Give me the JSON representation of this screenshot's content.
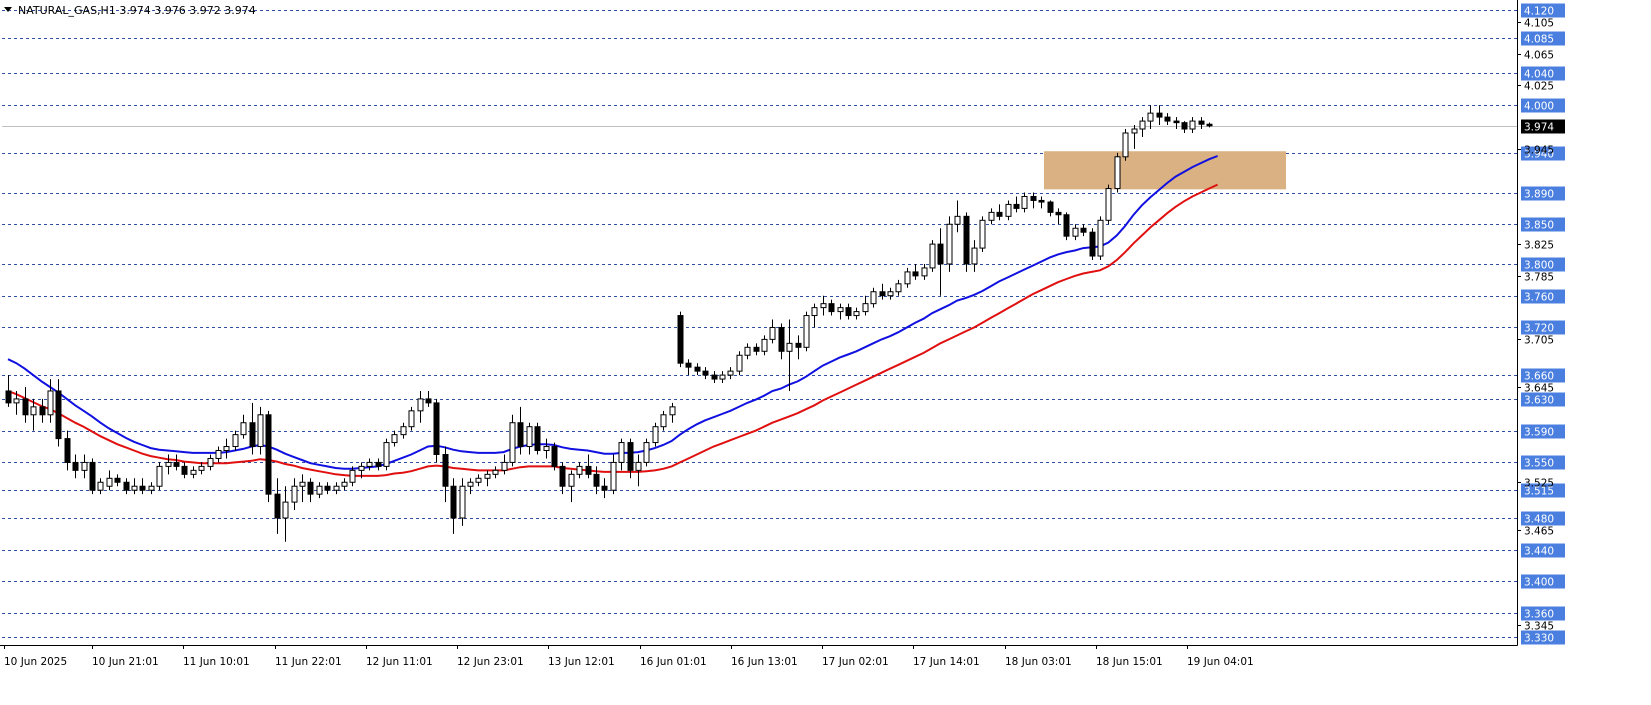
{
  "header": {
    "symbol_line": "NATURAL_GAS,H1  3.974 3.976 3.972 3.974"
  },
  "colors": {
    "level_line": "#2f4fa2",
    "level_badge": "#4a7fe0",
    "ema_fast": "#1010e0",
    "ema_slow": "#e01010",
    "zone": "#d9b183",
    "price_badge": "#000000"
  },
  "chart_data": {
    "type": "candlestick",
    "timeframe": "H1",
    "ylim": [
      3.32,
      4.13
    ],
    "current_price": 3.974,
    "x_labels": [
      "10 Jun 2025",
      "10 Jun 21:01",
      "11 Jun 10:01",
      "11 Jun 22:01",
      "12 Jun 11:01",
      "12 Jun 23:01",
      "13 Jun 12:01",
      "16 Jun 01:01",
      "16 Jun 13:01",
      "17 Jun 02:01",
      "17 Jun 14:01",
      "18 Jun 03:01",
      "18 Jun 15:01",
      "19 Jun 04:01"
    ],
    "price_ticks": [
      "4.105",
      "4.065",
      "4.025",
      "3.945",
      "3.825",
      "3.785",
      "3.705",
      "3.645",
      "3.525",
      "3.465",
      "3.345"
    ],
    "levels": [
      "4.120",
      "4.085",
      "4.040",
      "4.000",
      "3.940",
      "3.890",
      "3.850",
      "3.800",
      "3.760",
      "3.720",
      "3.660",
      "3.630",
      "3.590",
      "3.550",
      "3.515",
      "3.480",
      "3.440",
      "3.400",
      "3.360",
      "3.330"
    ],
    "zone": {
      "low": 3.894,
      "high": 3.942
    },
    "candles": [
      [
        3.64,
        3.66,
        3.62,
        3.625
      ],
      [
        3.625,
        3.64,
        3.61,
        3.63
      ],
      [
        3.63,
        3.645,
        3.6,
        3.61
      ],
      [
        3.61,
        3.63,
        3.59,
        3.62
      ],
      [
        3.62,
        3.63,
        3.6,
        3.61
      ],
      [
        3.61,
        3.655,
        3.6,
        3.64
      ],
      [
        3.64,
        3.655,
        3.57,
        3.58
      ],
      [
        3.58,
        3.59,
        3.54,
        3.55
      ],
      [
        3.55,
        3.56,
        3.53,
        3.54
      ],
      [
        3.54,
        3.56,
        3.53,
        3.55
      ],
      [
        3.55,
        3.555,
        3.51,
        3.515
      ],
      [
        3.515,
        3.53,
        3.51,
        3.525
      ],
      [
        3.52,
        3.54,
        3.515,
        3.53
      ],
      [
        3.53,
        3.535,
        3.52,
        3.525
      ],
      [
        3.525,
        3.53,
        3.51,
        3.515
      ],
      [
        3.515,
        3.53,
        3.51,
        3.52
      ],
      [
        3.52,
        3.53,
        3.51,
        3.515
      ],
      [
        3.515,
        3.525,
        3.51,
        3.52
      ],
      [
        3.52,
        3.55,
        3.515,
        3.545
      ],
      [
        3.545,
        3.56,
        3.535,
        3.55
      ],
      [
        3.55,
        3.56,
        3.54,
        3.545
      ],
      [
        3.545,
        3.55,
        3.53,
        3.535
      ],
      [
        3.535,
        3.545,
        3.53,
        3.54
      ],
      [
        3.54,
        3.55,
        3.535,
        3.545
      ],
      [
        3.545,
        3.56,
        3.54,
        3.555
      ],
      [
        3.555,
        3.57,
        3.55,
        3.565
      ],
      [
        3.565,
        3.58,
        3.555,
        3.57
      ],
      [
        3.57,
        3.59,
        3.565,
        3.585
      ],
      [
        3.585,
        3.61,
        3.58,
        3.6
      ],
      [
        3.6,
        3.625,
        3.56,
        3.57
      ],
      [
        3.57,
        3.62,
        3.56,
        3.61
      ],
      [
        3.61,
        3.615,
        3.5,
        3.51
      ],
      [
        3.51,
        3.53,
        3.46,
        3.48
      ],
      [
        3.48,
        3.52,
        3.45,
        3.5
      ],
      [
        3.5,
        3.53,
        3.49,
        3.52
      ],
      [
        3.52,
        3.535,
        3.5,
        3.525
      ],
      [
        3.525,
        3.53,
        3.5,
        3.51
      ],
      [
        3.51,
        3.525,
        3.505,
        3.52
      ],
      [
        3.52,
        3.525,
        3.51,
        3.515
      ],
      [
        3.515,
        3.525,
        3.51,
        3.52
      ],
      [
        3.52,
        3.53,
        3.515,
        3.525
      ],
      [
        3.525,
        3.545,
        3.52,
        3.54
      ],
      [
        3.54,
        3.55,
        3.53,
        3.545
      ],
      [
        3.545,
        3.555,
        3.54,
        3.55
      ],
      [
        3.55,
        3.555,
        3.54,
        3.545
      ],
      [
        3.545,
        3.58,
        3.54,
        3.575
      ],
      [
        3.575,
        3.59,
        3.57,
        3.585
      ],
      [
        3.585,
        3.6,
        3.58,
        3.595
      ],
      [
        3.595,
        3.62,
        3.59,
        3.615
      ],
      [
        3.615,
        3.64,
        3.6,
        3.63
      ],
      [
        3.63,
        3.64,
        3.62,
        3.625
      ],
      [
        3.625,
        3.63,
        3.55,
        3.56
      ],
      [
        3.56,
        3.57,
        3.5,
        3.52
      ],
      [
        3.52,
        3.53,
        3.46,
        3.48
      ],
      [
        3.48,
        3.53,
        3.47,
        3.52
      ],
      [
        3.52,
        3.53,
        3.51,
        3.525
      ],
      [
        3.525,
        3.535,
        3.52,
        3.53
      ],
      [
        3.53,
        3.54,
        3.52,
        3.535
      ],
      [
        3.535,
        3.545,
        3.53,
        3.54
      ],
      [
        3.54,
        3.56,
        3.535,
        3.55
      ],
      [
        3.55,
        3.61,
        3.545,
        3.6
      ],
      [
        3.6,
        3.62,
        3.56,
        3.57
      ],
      [
        3.57,
        3.6,
        3.56,
        3.595
      ],
      [
        3.595,
        3.6,
        3.56,
        3.565
      ],
      [
        3.565,
        3.58,
        3.555,
        3.57
      ],
      [
        3.57,
        3.575,
        3.54,
        3.545
      ],
      [
        3.545,
        3.55,
        3.51,
        3.52
      ],
      [
        3.52,
        3.54,
        3.5,
        3.535
      ],
      [
        3.535,
        3.55,
        3.53,
        3.545
      ],
      [
        3.545,
        3.56,
        3.53,
        3.535
      ],
      [
        3.535,
        3.545,
        3.51,
        3.52
      ],
      [
        3.52,
        3.53,
        3.505,
        3.515
      ],
      [
        3.515,
        3.56,
        3.51,
        3.55
      ],
      [
        3.55,
        3.58,
        3.54,
        3.575
      ],
      [
        3.575,
        3.58,
        3.53,
        3.54
      ],
      [
        3.54,
        3.56,
        3.52,
        3.55
      ],
      [
        3.55,
        3.58,
        3.545,
        3.575
      ],
      [
        3.575,
        3.6,
        3.57,
        3.595
      ],
      [
        3.595,
        3.615,
        3.59,
        3.61
      ],
      [
        3.61,
        3.625,
        3.6,
        3.62
      ],
      [
        3.735,
        3.74,
        3.67,
        3.675
      ],
      [
        3.675,
        3.68,
        3.66,
        3.67
      ],
      [
        3.67,
        3.675,
        3.66,
        3.665
      ],
      [
        3.665,
        3.67,
        3.655,
        3.66
      ],
      [
        3.66,
        3.665,
        3.65,
        3.655
      ],
      [
        3.655,
        3.665,
        3.65,
        3.66
      ],
      [
        3.66,
        3.67,
        3.655,
        3.665
      ],
      [
        3.665,
        3.69,
        3.66,
        3.685
      ],
      [
        3.685,
        3.7,
        3.68,
        3.695
      ],
      [
        3.695,
        3.7,
        3.685,
        3.69
      ],
      [
        3.69,
        3.71,
        3.685,
        3.705
      ],
      [
        3.705,
        3.73,
        3.7,
        3.72
      ],
      [
        3.72,
        3.725,
        3.68,
        3.69
      ],
      [
        3.69,
        3.73,
        3.64,
        3.7
      ],
      [
        3.7,
        3.71,
        3.68,
        3.695
      ],
      [
        3.695,
        3.74,
        3.69,
        3.735
      ],
      [
        3.735,
        3.75,
        3.72,
        3.745
      ],
      [
        3.745,
        3.76,
        3.735,
        3.75
      ],
      [
        3.75,
        3.755,
        3.735,
        3.74
      ],
      [
        3.74,
        3.75,
        3.73,
        3.745
      ],
      [
        3.745,
        3.75,
        3.73,
        3.735
      ],
      [
        3.735,
        3.745,
        3.73,
        3.74
      ],
      [
        3.74,
        3.76,
        3.735,
        3.75
      ],
      [
        3.75,
        3.77,
        3.745,
        3.765
      ],
      [
        3.765,
        3.775,
        3.755,
        3.76
      ],
      [
        3.76,
        3.77,
        3.755,
        3.765
      ],
      [
        3.765,
        3.78,
        3.76,
        3.775
      ],
      [
        3.775,
        3.795,
        3.77,
        3.79
      ],
      [
        3.79,
        3.8,
        3.78,
        3.785
      ],
      [
        3.785,
        3.8,
        3.78,
        3.795
      ],
      [
        3.795,
        3.83,
        3.79,
        3.825
      ],
      [
        3.825,
        3.845,
        3.76,
        3.8
      ],
      [
        3.8,
        3.86,
        3.79,
        3.85
      ],
      [
        3.85,
        3.88,
        3.84,
        3.86
      ],
      [
        3.86,
        3.865,
        3.79,
        3.8
      ],
      [
        3.8,
        3.83,
        3.79,
        3.82
      ],
      [
        3.82,
        3.86,
        3.815,
        3.855
      ],
      [
        3.855,
        3.87,
        3.85,
        3.865
      ],
      [
        3.865,
        3.875,
        3.855,
        3.86
      ],
      [
        3.86,
        3.88,
        3.855,
        3.875
      ],
      [
        3.875,
        3.885,
        3.865,
        3.87
      ],
      [
        3.87,
        3.89,
        3.865,
        3.885
      ],
      [
        3.885,
        3.89,
        3.87,
        3.88
      ],
      [
        3.88,
        3.885,
        3.87,
        3.878
      ],
      [
        3.878,
        3.88,
        3.86,
        3.865
      ],
      [
        3.865,
        3.87,
        3.85,
        3.862
      ],
      [
        3.862,
        3.865,
        3.83,
        3.835
      ],
      [
        3.835,
        3.85,
        3.83,
        3.845
      ],
      [
        3.845,
        3.85,
        3.835,
        3.84
      ],
      [
        3.84,
        3.845,
        3.805,
        3.81
      ],
      [
        3.81,
        3.86,
        3.805,
        3.855
      ],
      [
        3.855,
        3.9,
        3.85,
        3.895
      ],
      [
        3.895,
        3.94,
        3.89,
        3.935
      ],
      [
        3.935,
        3.97,
        3.93,
        3.965
      ],
      [
        3.965,
        3.975,
        3.945,
        3.97
      ],
      [
        3.97,
        3.985,
        3.96,
        3.98
      ],
      [
        3.98,
        4.0,
        3.97,
        3.99
      ],
      [
        3.99,
        4.0,
        3.975,
        3.985
      ],
      [
        3.985,
        3.99,
        3.975,
        3.98
      ],
      [
        3.98,
        3.985,
        3.97,
        3.978
      ],
      [
        3.978,
        3.98,
        3.965,
        3.97
      ],
      [
        3.97,
        3.985,
        3.965,
        3.98
      ],
      [
        3.98,
        3.985,
        3.97,
        3.976
      ],
      [
        3.976,
        3.978,
        3.972,
        3.974
      ]
    ],
    "series": [
      {
        "values": [
          3.68,
          3.675,
          3.668,
          3.66,
          3.652,
          3.645,
          3.638,
          3.63,
          3.622,
          3.615,
          3.608,
          3.6,
          3.593,
          3.587,
          3.581,
          3.576,
          3.572,
          3.568,
          3.566,
          3.565,
          3.564,
          3.563,
          3.562,
          3.562,
          3.562,
          3.562,
          3.563,
          3.565,
          3.567,
          3.57,
          3.572,
          3.57,
          3.566,
          3.561,
          3.557,
          3.553,
          3.549,
          3.547,
          3.545,
          3.543,
          3.542,
          3.542,
          3.543,
          3.544,
          3.545,
          3.548,
          3.552,
          3.556,
          3.56,
          3.565,
          3.57,
          3.571,
          3.569,
          3.566,
          3.564,
          3.563,
          3.562,
          3.562,
          3.562,
          3.563,
          3.567,
          3.57,
          3.572,
          3.573,
          3.573,
          3.572,
          3.569,
          3.567,
          3.566,
          3.565,
          3.563,
          3.561,
          3.561,
          3.562,
          3.562,
          3.563,
          3.565,
          3.568,
          3.572,
          3.577,
          3.585,
          3.592,
          3.598,
          3.603,
          3.607,
          3.611,
          3.615,
          3.62,
          3.625,
          3.629,
          3.634,
          3.64,
          3.643,
          3.648,
          3.652,
          3.658,
          3.665,
          3.672,
          3.677,
          3.682,
          3.686,
          3.69,
          3.695,
          3.7,
          3.705,
          3.709,
          3.714,
          3.72,
          3.726,
          3.731,
          3.738,
          3.743,
          3.748,
          3.754,
          3.757,
          3.761,
          3.766,
          3.772,
          3.778,
          3.783,
          3.788,
          3.793,
          3.798,
          3.803,
          3.808,
          3.812,
          3.815,
          3.817,
          3.82,
          3.821,
          3.822,
          3.827,
          3.836,
          3.848,
          3.862,
          3.874,
          3.884,
          3.893,
          3.902,
          3.91,
          3.916,
          3.922,
          3.927,
          3.932,
          3.936
        ]
      },
      {
        "values": [
          3.64,
          3.636,
          3.631,
          3.626,
          3.621,
          3.617,
          3.612,
          3.606,
          3.6,
          3.595,
          3.589,
          3.583,
          3.578,
          3.573,
          3.569,
          3.565,
          3.561,
          3.558,
          3.556,
          3.554,
          3.553,
          3.551,
          3.55,
          3.549,
          3.549,
          3.549,
          3.549,
          3.55,
          3.551,
          3.552,
          3.554,
          3.553,
          3.551,
          3.548,
          3.546,
          3.543,
          3.541,
          3.539,
          3.537,
          3.535,
          3.534,
          3.533,
          3.533,
          3.533,
          3.533,
          3.534,
          3.536,
          3.537,
          3.539,
          3.542,
          3.545,
          3.546,
          3.545,
          3.543,
          3.542,
          3.541,
          3.54,
          3.54,
          3.54,
          3.54,
          3.542,
          3.544,
          3.545,
          3.545,
          3.545,
          3.545,
          3.543,
          3.542,
          3.541,
          3.54,
          3.539,
          3.538,
          3.538,
          3.538,
          3.538,
          3.538,
          3.539,
          3.54,
          3.542,
          3.545,
          3.55,
          3.555,
          3.56,
          3.565,
          3.57,
          3.574,
          3.578,
          3.582,
          3.586,
          3.59,
          3.595,
          3.6,
          3.604,
          3.608,
          3.612,
          3.617,
          3.622,
          3.628,
          3.633,
          3.638,
          3.643,
          3.648,
          3.653,
          3.658,
          3.663,
          3.668,
          3.673,
          3.678,
          3.683,
          3.688,
          3.694,
          3.7,
          3.705,
          3.71,
          3.715,
          3.72,
          3.726,
          3.732,
          3.738,
          3.744,
          3.75,
          3.756,
          3.762,
          3.767,
          3.772,
          3.777,
          3.781,
          3.785,
          3.788,
          3.79,
          3.792,
          3.797,
          3.805,
          3.815,
          3.826,
          3.836,
          3.846,
          3.855,
          3.864,
          3.872,
          3.879,
          3.885,
          3.89,
          3.895,
          3.9
        ]
      }
    ]
  }
}
